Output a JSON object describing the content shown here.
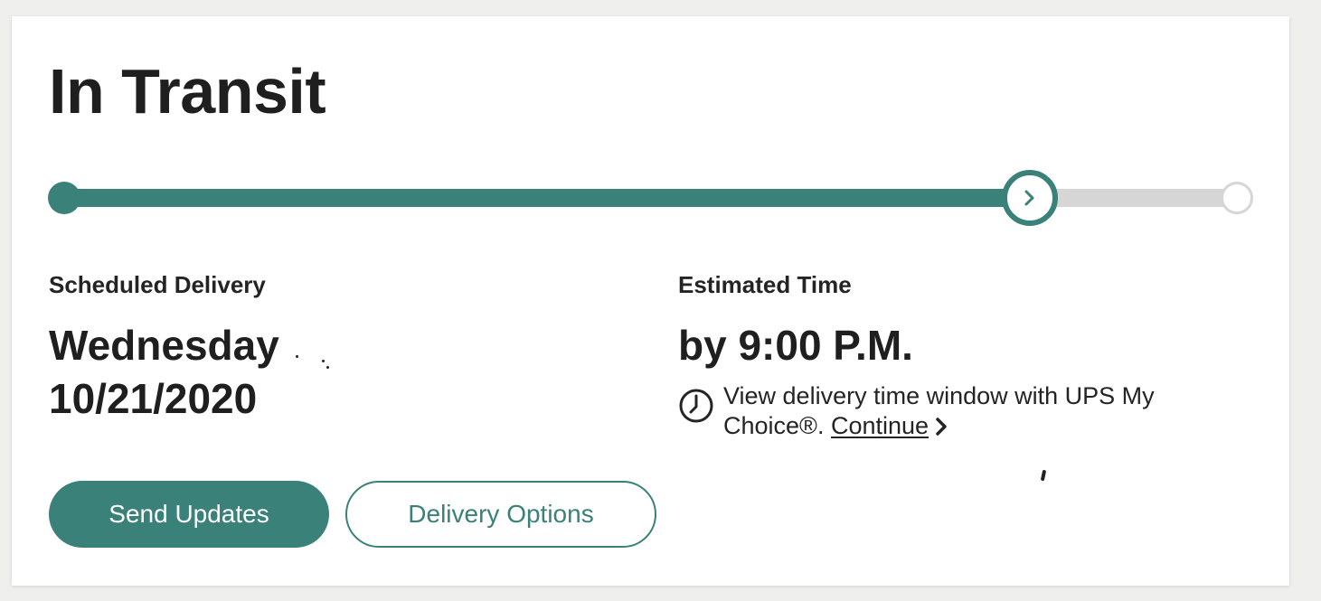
{
  "status": {
    "title": "In Transit"
  },
  "progress": {
    "fraction_complete": 0.815,
    "steps": [
      "start",
      "current",
      "end"
    ],
    "current_step_icon": "chevron-right-icon"
  },
  "scheduled_delivery": {
    "label": "Scheduled Delivery",
    "day": "Wednesday",
    "date": "10/21/2020"
  },
  "estimated_time": {
    "label": "Estimated Time",
    "value": "by 9:00 P.M.",
    "info_icon": "clock-icon",
    "info_text": "View delivery time window with UPS My Choice®.",
    "link_label": "Continue",
    "link_icon": "chevron-right-icon"
  },
  "buttons": {
    "send_updates": "Send Updates",
    "delivery_options": "Delivery Options"
  },
  "colors": {
    "accent": "#3a8179",
    "track": "#d6d6d6",
    "text": "#242424",
    "background": "#efefee",
    "card": "#ffffff"
  }
}
